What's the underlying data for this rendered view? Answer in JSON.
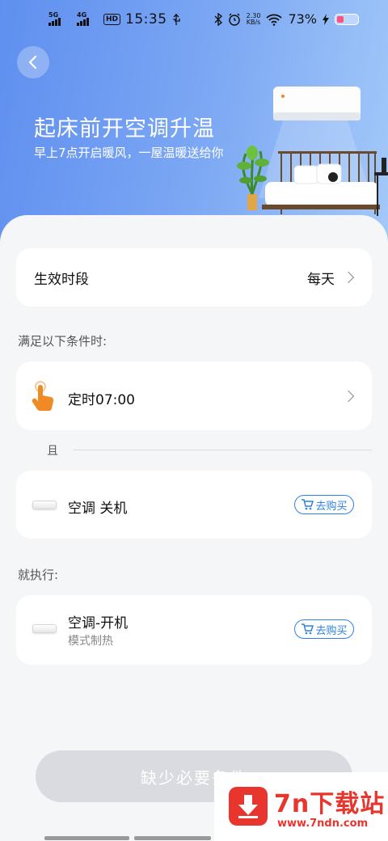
{
  "status_bar": {
    "sim1": "5G",
    "sim2": "4G",
    "hd": "HD",
    "time": "15:35",
    "speed_value": "2.30",
    "speed_unit": "KB/s",
    "battery": "73%",
    "icons": [
      "bluetooth-icon",
      "alarm-icon",
      "wifi-icon",
      "charging-icon",
      "usb-icon"
    ]
  },
  "header": {
    "title": "起床前开空调升温",
    "subtitle": "早上7点开启暖风，一屋温暖送给你"
  },
  "period": {
    "label": "生效时段",
    "value": "每天"
  },
  "conditions": {
    "heading": "满足以下条件时:",
    "timer_label": "定时07:00",
    "and_label": "且",
    "device_label": "空调 关机",
    "buy_label": "去购买"
  },
  "actions": {
    "heading": "就执行:",
    "device_label": "空调-开机",
    "device_sub": "模式制热",
    "buy_label": "去购买"
  },
  "bottom_button": "缺少必要条件",
  "watermark": {
    "title": "7n下载站",
    "url": "www.7ndn.com"
  },
  "colors": {
    "accent": "#2d82e6",
    "hero_start": "#5f8ff0",
    "hero_end": "#a3c9f9",
    "hand_icon": "#f08a24",
    "watermark": "#e8362f"
  }
}
